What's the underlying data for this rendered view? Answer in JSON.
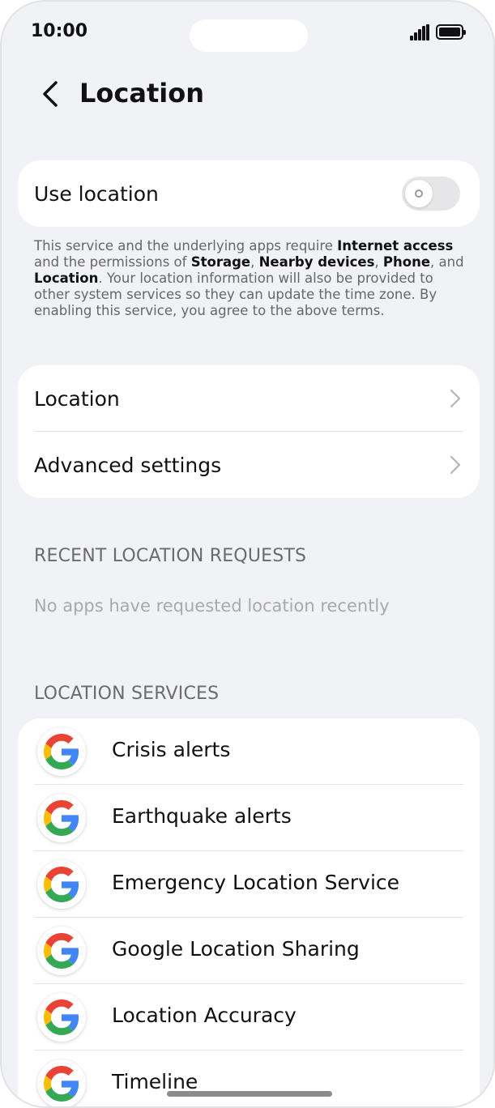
{
  "status_bar": {
    "time": "10:00"
  },
  "header": {
    "title": "Location"
  },
  "use_location": {
    "label": "Use location",
    "enabled": false
  },
  "terms": {
    "part1": "This service and the underlying apps require ",
    "internet_access": "Internet access",
    "part2": " and the permissions of ",
    "storage": "Storage",
    "sep1": ", ",
    "nearby_devices": "Nearby devices",
    "sep2": ", ",
    "phone": "Phone",
    "part3": ", and ",
    "location": "Location",
    "part4": ". Your location information will also be provided to other system services so they can update the time zone. By enabling this service, you agree to the above terms."
  },
  "settings": {
    "items": [
      {
        "label": "Location"
      },
      {
        "label": "Advanced settings"
      }
    ]
  },
  "recent_requests": {
    "header": "RECENT LOCATION REQUESTS",
    "empty_text": "No apps have requested location recently"
  },
  "location_services": {
    "header": "LOCATION SERVICES",
    "icon": "google-g-icon",
    "items": [
      {
        "label": "Crisis alerts"
      },
      {
        "label": "Earthquake alerts"
      },
      {
        "label": "Emergency Location Service"
      },
      {
        "label": "Google Location Sharing"
      },
      {
        "label": "Location Accuracy"
      },
      {
        "label": "Timeline"
      }
    ]
  },
  "colors": {
    "background": "#f1f2f5",
    "card": "#ffffff",
    "google_blue": "#4285F4",
    "google_red": "#EA4335",
    "google_yellow": "#FBBC05",
    "google_green": "#34A853"
  }
}
